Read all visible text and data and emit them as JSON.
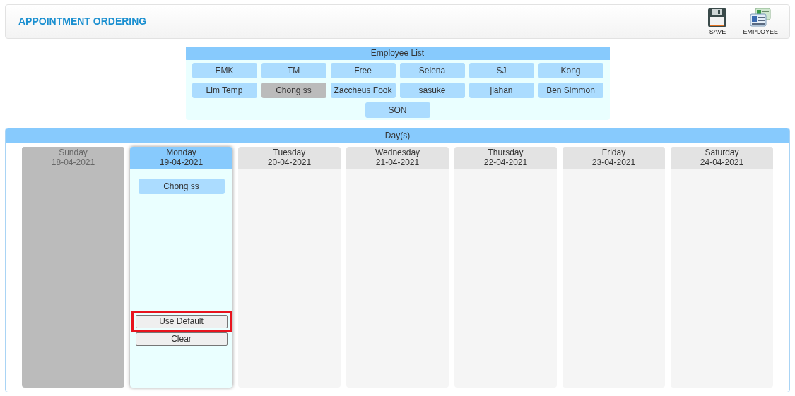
{
  "header": {
    "title": "APPOINTMENT ORDERING",
    "actions": [
      {
        "kind": "save",
        "label": "SAVE"
      },
      {
        "kind": "employee",
        "label": "EMPLOYEE"
      }
    ]
  },
  "employee_list": {
    "title": "Employee List",
    "employees": [
      {
        "name": "EMK",
        "selected": false
      },
      {
        "name": "TM",
        "selected": false
      },
      {
        "name": "Free",
        "selected": false
      },
      {
        "name": "Selena",
        "selected": false
      },
      {
        "name": "SJ",
        "selected": false
      },
      {
        "name": "Kong",
        "selected": false
      },
      {
        "name": "Lim Temp",
        "selected": false
      },
      {
        "name": "Chong ss",
        "selected": true
      },
      {
        "name": "Zaccheus Fook",
        "selected": false
      },
      {
        "name": "sasuke",
        "selected": false
      },
      {
        "name": "jiahan",
        "selected": false
      },
      {
        "name": "Ben Simmon",
        "selected": false
      },
      {
        "name": "SON",
        "selected": false
      }
    ]
  },
  "days_panel": {
    "title": "Day(s)",
    "days": [
      {
        "day": "Sunday",
        "date": "18-04-2021",
        "disabled": true,
        "selected": false
      },
      {
        "day": "Monday",
        "date": "19-04-2021",
        "disabled": false,
        "selected": true,
        "employees": [
          "Chong ss"
        ],
        "buttons": [
          {
            "label": "Use Default",
            "highlighted": true
          },
          {
            "label": "Clear",
            "highlighted": false
          }
        ]
      },
      {
        "day": "Tuesday",
        "date": "20-04-2021",
        "disabled": false,
        "selected": false
      },
      {
        "day": "Wednesday",
        "date": "21-04-2021",
        "disabled": false,
        "selected": false
      },
      {
        "day": "Thursday",
        "date": "22-04-2021",
        "disabled": false,
        "selected": false
      },
      {
        "day": "Friday",
        "date": "23-04-2021",
        "disabled": false,
        "selected": false
      },
      {
        "day": "Saturday",
        "date": "24-04-2021",
        "disabled": false,
        "selected": false
      }
    ]
  }
}
